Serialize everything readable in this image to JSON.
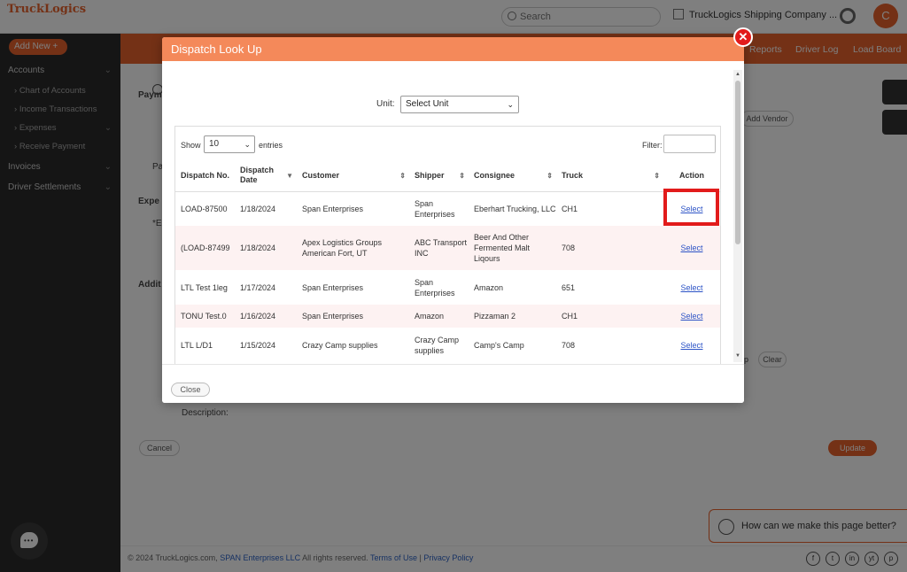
{
  "app": {
    "logo_text": "TruckLogics",
    "search_placeholder": "Search",
    "company_name": "TruckLogics Shipping Company ...",
    "avatar_initial": "C",
    "add_new_label": "Add New"
  },
  "sidebar": {
    "items": [
      {
        "label": "Accounts",
        "sub": false,
        "chevron": true
      },
      {
        "label": "Chart of Accounts",
        "sub": true,
        "chevron": false
      },
      {
        "label": "Income Transactions",
        "sub": true,
        "chevron": false
      },
      {
        "label": "Expenses",
        "sub": true,
        "chevron": true
      },
      {
        "label": "Receive Payment",
        "sub": true,
        "chevron": false
      },
      {
        "label": "Invoices",
        "sub": false,
        "chevron": true
      },
      {
        "label": "Driver Settlements",
        "sub": false,
        "chevron": true
      }
    ]
  },
  "topnav": {
    "reports": "Reports",
    "driver_log": "Driver Log",
    "load_board": "Load Board"
  },
  "background": {
    "paym": "Paym",
    "pa": "Pa",
    "expe": "Expe",
    "e_star": "*E",
    "addit": "Addit",
    "add_vendor": "Add Vendor",
    "description": "Description:",
    "cancel": "Cancel",
    "update": "Update",
    "clear": "Clear",
    "p": "p"
  },
  "feedback": {
    "text": "How can we make this page better?"
  },
  "footer": {
    "copyright_prefix": "© 2024 TruckLogics.com,",
    "company_link": "SPAN Enterprises LLC",
    "rights": "All rights reserved.",
    "terms": "Terms of Use",
    "separator": "|",
    "privacy": "Privacy Policy"
  },
  "social_icons": [
    "f",
    "t",
    "in",
    "yt",
    "p"
  ],
  "modal": {
    "title": "Dispatch Look Up",
    "unit_label": "Unit:",
    "unit_value": "Select Unit",
    "show_label": "Show",
    "show_value": "10",
    "entries_label": "entries",
    "filter_label": "Filter:",
    "close_button": "Close",
    "columns": [
      "Dispatch No.",
      "Dispatch Date",
      "Customer",
      "Shipper",
      "Consignee",
      "Truck",
      "Action"
    ],
    "rows": [
      {
        "dispatch_no": "LOAD-87500",
        "date": "1/18/2024",
        "customer": "Span Enterprises",
        "shipper": "Span Enterprises",
        "consignee": "Eberhart Trucking, LLC",
        "truck": "CH1",
        "action": "Select"
      },
      {
        "dispatch_no": "(LOAD-87499",
        "date": "1/18/2024",
        "customer": "Apex Logistics Groups American Fort, UT",
        "shipper": "ABC Transport INC",
        "consignee": "Beer And Other Fermented Malt Liqours",
        "truck": "708",
        "action": "Select"
      },
      {
        "dispatch_no": "LTL Test 1leg",
        "date": "1/17/2024",
        "customer": "Span Enterprises",
        "shipper": "Span Enterprises",
        "consignee": "Amazon",
        "truck": "651",
        "action": "Select"
      },
      {
        "dispatch_no": "TONU Test.0",
        "date": "1/16/2024",
        "customer": "Span Enterprises",
        "shipper": "Amazon",
        "consignee": "Pizzaman 2",
        "truck": "CH1",
        "action": "Select"
      },
      {
        "dispatch_no": "LTL L/D1",
        "date": "1/15/2024",
        "customer": "Crazy Camp supplies",
        "shipper": "Crazy Camp supplies",
        "consignee": "Camp's Camp",
        "truck": "708",
        "action": "Select"
      }
    ]
  },
  "colors": {
    "brand_orange": "#e8622c",
    "modal_header": "#f4895a",
    "highlight_red": "#e21b1b",
    "link_blue": "#2c53c6"
  }
}
